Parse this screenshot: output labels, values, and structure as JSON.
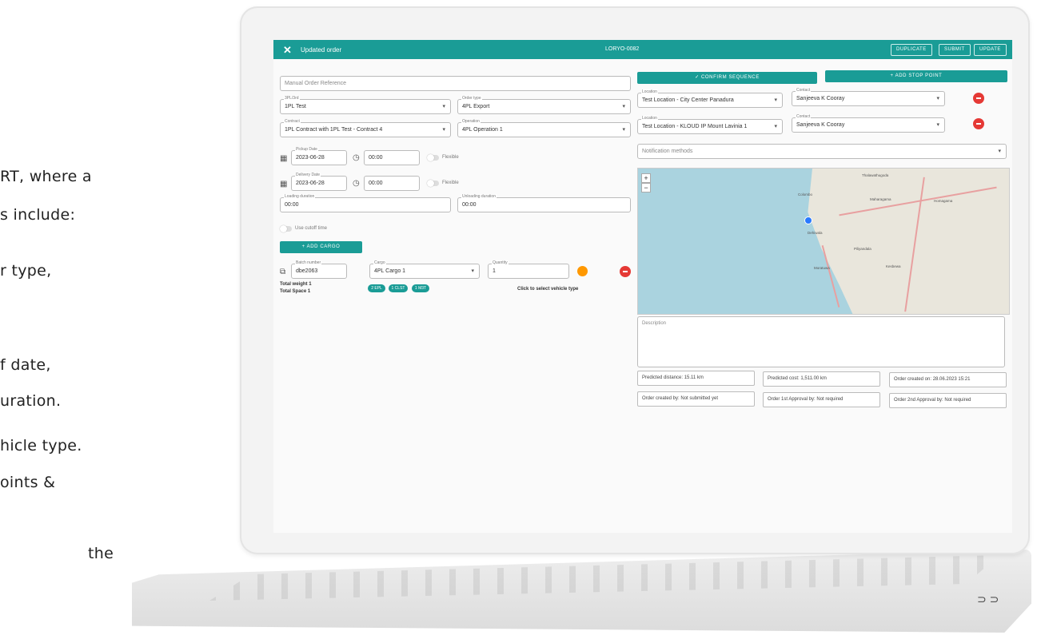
{
  "side_text": [
    "RT, where a",
    "s include:",
    "r type,",
    "f date,",
    "uration.",
    "hicle type.",
    "oints &",
    "the"
  ],
  "topbar": {
    "title": "Updated order",
    "order_no": "LORYO-0082",
    "buttons": [
      "DUPLICATE",
      "SUBMIT",
      "UPDATE"
    ],
    "color": "#1a9c96"
  },
  "left": {
    "manual_ref_placeholder": "Manual Order Reference",
    "three_pl": {
      "label": "3PL/3rd",
      "value": "1PL Test"
    },
    "order_type": {
      "label": "Order type",
      "value": "4PL Export"
    },
    "contract": {
      "label": "Contract",
      "value": "1PL Contract with 1PL Test - Contract 4"
    },
    "operation": {
      "label": "Operation",
      "value": "4PL Operation 1"
    },
    "pickup": {
      "label": "Pickup Date",
      "date": "2023-06-28",
      "time": "00:00",
      "flexible": "Flexible"
    },
    "delivery": {
      "label": "Delivery Date",
      "date": "2023-06-28",
      "time": "00:00",
      "flexible": "Flexible"
    },
    "loading": {
      "label": "Loading duration",
      "value": "00:00"
    },
    "unloading": {
      "label": "Unloading duration",
      "value": "00:00"
    },
    "cutoff": "Use cutoff time",
    "add_cargo": "ADD CARGO",
    "cargo": {
      "batch_label": "Batch number",
      "batch": "dbe2063",
      "cargo_label": "Cargo",
      "cargo": "4PL Cargo 1",
      "qty_label": "Quantity",
      "qty": "1"
    },
    "total_weight": "Total weight 1",
    "total_space": "Total Space 1",
    "pills": [
      "2 EPL",
      "1 CLST",
      "1 M3T"
    ],
    "select_vehicle": "Click to select vehicle type"
  },
  "right": {
    "confirm_sequence": "CONFIRM SEQUENCE",
    "add_stop_point": "ADD STOP POINT",
    "stops": [
      {
        "loc_label": "Location",
        "location": "Test Location - City Center Panadura",
        "con_label": "Contact",
        "contact": "Sanjeeva K Cooray"
      },
      {
        "loc_label": "Location",
        "location": "Test Location - KLOUD IP Mount Lavinia 1",
        "con_label": "Contact",
        "contact": "Sanjeeva K Cooray"
      }
    ],
    "notification": "Notification methods",
    "map_places": [
      "Thalawathugoda",
      "Maharagama",
      "Homagama",
      "Moratuwa",
      "Piliyandala",
      "Kesbewa",
      "Colombo",
      "Dehiwala"
    ],
    "description": "Description",
    "info": [
      "Predicted distance: 15.11 km",
      "Predicted cost: 1,511.00 km",
      "Order created on: 28.06.2023 15:21",
      "Order created by: Not submitted yet",
      "Order 1st Approval by: Not required",
      "Order 2nd Approval by: Not required"
    ]
  }
}
